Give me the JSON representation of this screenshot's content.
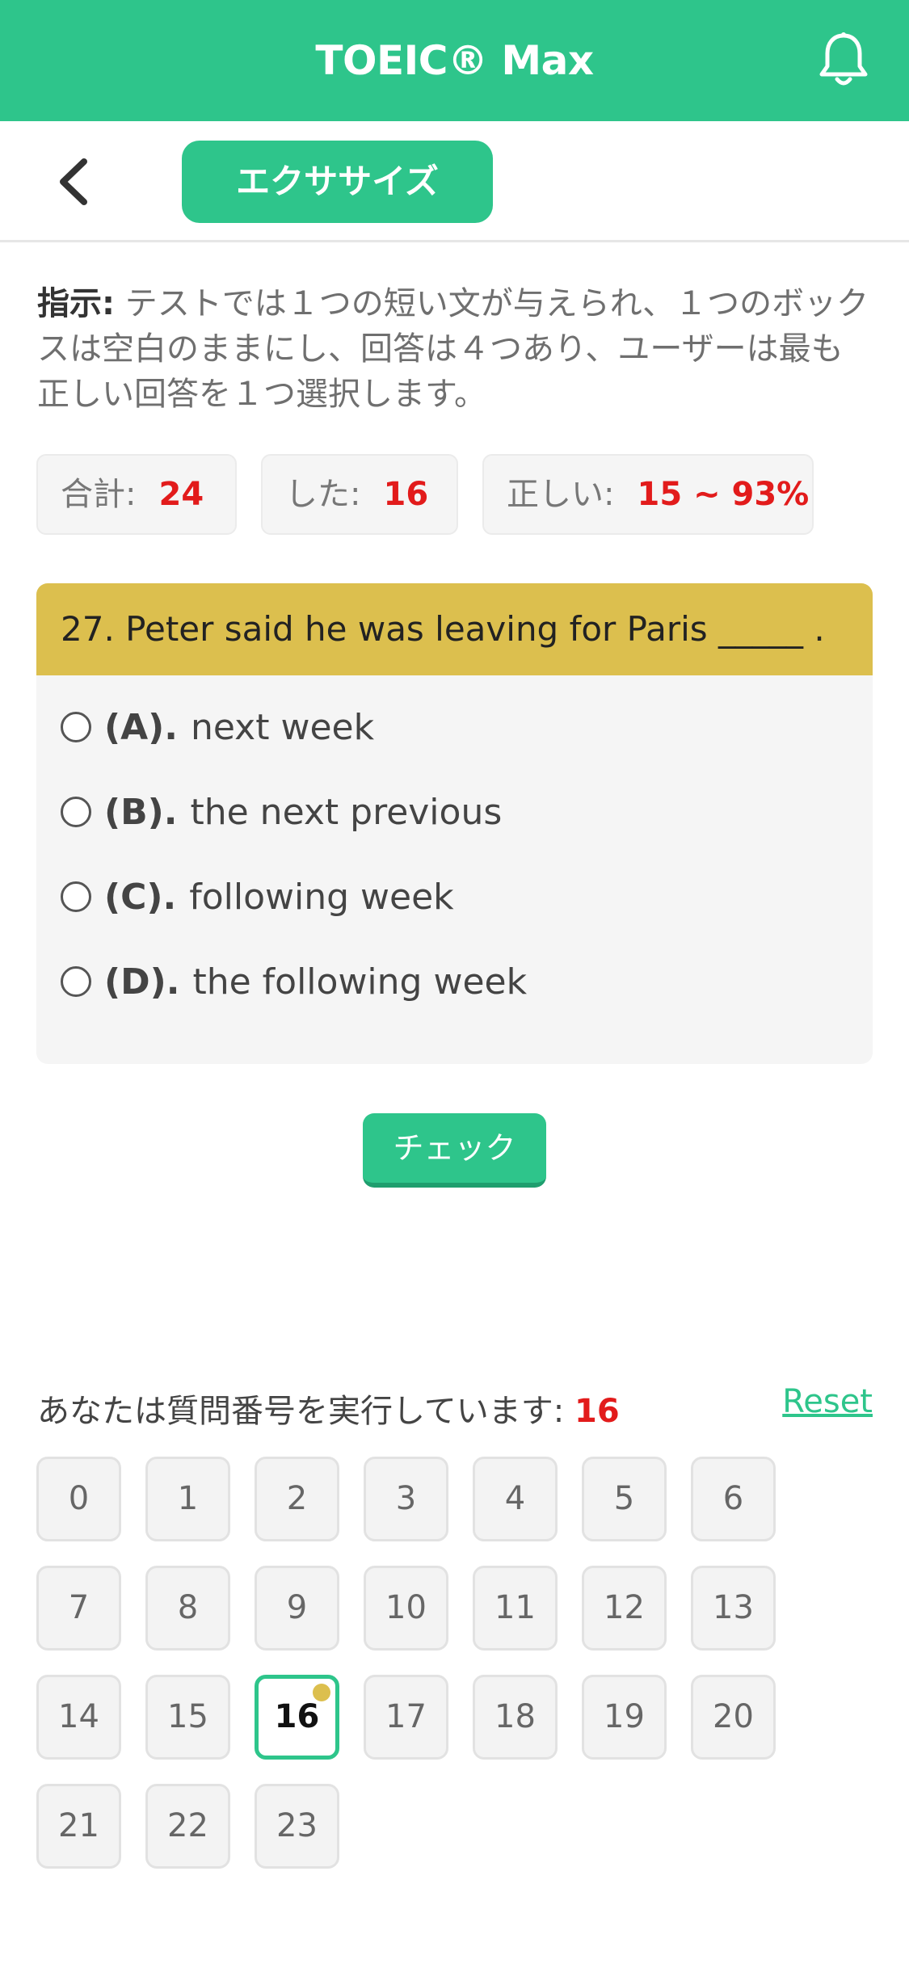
{
  "appbar": {
    "title": "TOEIC® Max",
    "icon": "bell-icon"
  },
  "subnav": {
    "back_icon": "chevron-left-icon",
    "tab_label": "エクササイズ"
  },
  "instructions": {
    "label": "指示:",
    "text": " テストでは１つの短い文が与えられ、１つのボックスは空白のままにし、回答は４つあり、ユーザーは最も正しい回答を１つ選択します。"
  },
  "stats": {
    "total_label": "合計:",
    "total_value": "24",
    "done_label": "した:",
    "done_value": "16",
    "correct_label": "正しい:",
    "correct_value": "15 ~ 93%"
  },
  "question": {
    "text": "27. Peter said he was leaving for Paris _____ .",
    "options": [
      {
        "label": "(A).",
        "text": "next week"
      },
      {
        "label": "(B).",
        "text": "the next previous"
      },
      {
        "label": "(C).",
        "text": "following week"
      },
      {
        "label": "(D).",
        "text": "the following week"
      }
    ]
  },
  "check_button": "チェック",
  "progress": {
    "label": "あなたは質問番号を実行しています:",
    "current": "16",
    "reset": "Reset"
  },
  "question_numbers": [
    "0",
    "1",
    "2",
    "3",
    "4",
    "5",
    "6",
    "7",
    "8",
    "9",
    "10",
    "11",
    "12",
    "13",
    "14",
    "15",
    "16",
    "17",
    "18",
    "19",
    "20",
    "21",
    "22",
    "23"
  ],
  "active_question": "16",
  "colors": {
    "brand": "#2ec58b",
    "question_header": "#dcbf4e",
    "highlight": "#e21b1b"
  }
}
